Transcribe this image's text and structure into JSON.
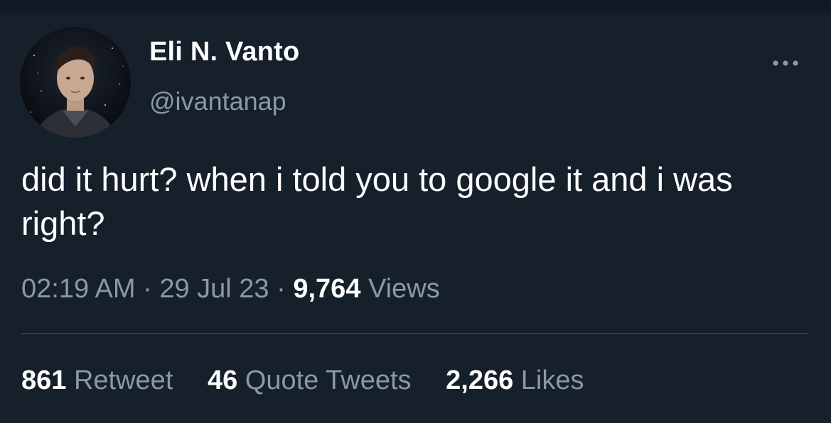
{
  "user": {
    "display_name": "Eli N. Vanto",
    "handle": "@ivantanap"
  },
  "tweet": {
    "text": "did it hurt? when i told you to google it and i was right?",
    "time": "02:19 AM",
    "date": "29 Jul 23",
    "separator": "·",
    "views_count": "9,764",
    "views_label": "Views"
  },
  "stats": {
    "retweets_count": "861",
    "retweets_label": "Retweet",
    "quotes_count": "46",
    "quotes_label": "Quote Tweets",
    "likes_count": "2,266",
    "likes_label": "Likes"
  },
  "icons": {
    "more": "more-options-icon",
    "avatar": "profile-avatar"
  },
  "colors": {
    "background": "#15202b",
    "primary_text": "#ffffff",
    "secondary_text": "#8b98a5",
    "divider": "#2f3b47"
  }
}
